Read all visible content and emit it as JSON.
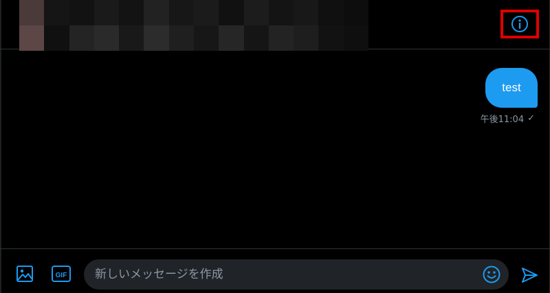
{
  "header": {
    "info_icon": "info-icon",
    "accent_highlight": "#e00000",
    "avatar_colors": [
      "#4a3a3a",
      "#151515",
      "#121212",
      "#1a1a1a",
      "#131313",
      "#222222",
      "#171717",
      "#1b1b1b",
      "#111111",
      "#1c1c1c",
      "#141414",
      "#181818",
      "#101010",
      "#0d0d0d",
      "#5c4646",
      "#101010",
      "#242424",
      "#2a2a2a",
      "#191919",
      "#2c2c2c",
      "#1f1f1f",
      "#171717",
      "#262626",
      "#151515",
      "#232323",
      "#1e1e1e",
      "#121212",
      "#0f0f0f"
    ]
  },
  "conversation": {
    "messages": [
      {
        "text": "test",
        "time": "午後11:04",
        "status": "✓",
        "sent": true
      }
    ]
  },
  "composer": {
    "placeholder": "新しいメッセージを作成",
    "gif_label": "GIF",
    "image_icon": "image-icon",
    "emoji_icon": "emoji-icon",
    "send_icon": "send-icon"
  },
  "colors": {
    "accent": "#1d9bf0",
    "bubble": "#1d9bf0",
    "background": "#000000",
    "input_bg": "#202327",
    "muted_text": "#8b98a5"
  }
}
